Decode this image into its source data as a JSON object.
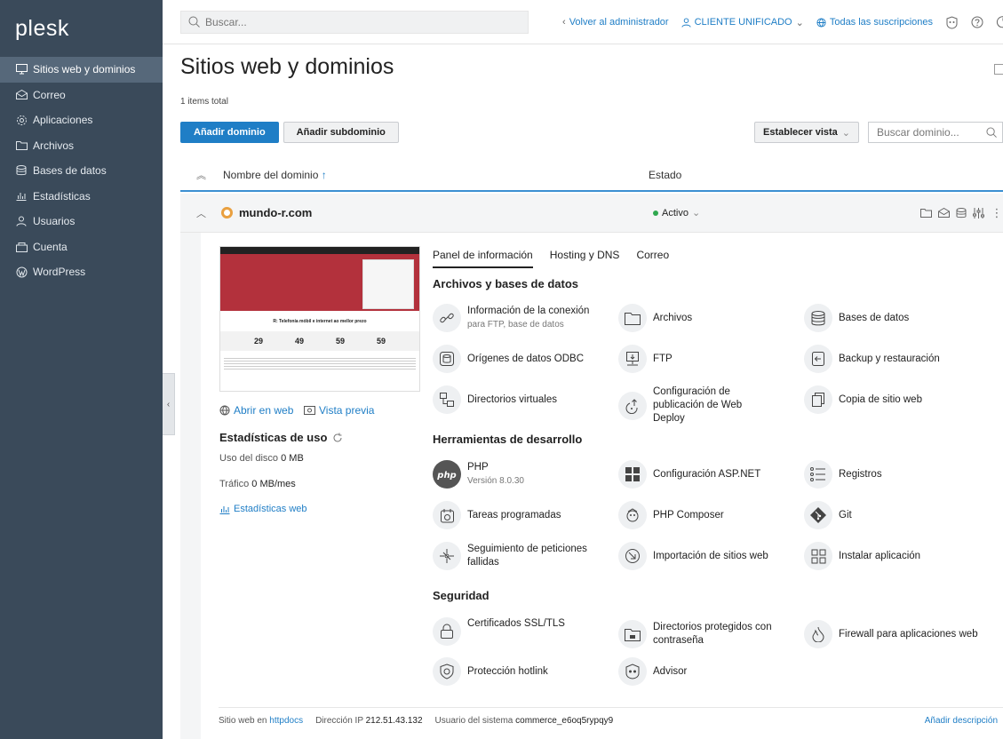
{
  "sidebar": {
    "logo": "plesk",
    "items": [
      {
        "label": "Sitios web y dominios",
        "icon": "monitor-icon",
        "active": true
      },
      {
        "label": "Correo",
        "icon": "mail-icon"
      },
      {
        "label": "Aplicaciones",
        "icon": "gear-icon"
      },
      {
        "label": "Archivos",
        "icon": "folder-icon"
      },
      {
        "label": "Bases de datos",
        "icon": "database-icon"
      },
      {
        "label": "Estadísticas",
        "icon": "bar-chart-icon"
      },
      {
        "label": "Usuarios",
        "icon": "user-icon"
      },
      {
        "label": "Cuenta",
        "icon": "account-icon"
      },
      {
        "label": "WordPress",
        "icon": "wordpress-icon"
      }
    ]
  },
  "topbar": {
    "search_placeholder": "Buscar...",
    "back_to_admin": "Volver al administrador",
    "customer": "CLIENTE UNIFICADO",
    "subscriptions": "Todas las suscripciones"
  },
  "page": {
    "title": "Sitios web y dominios",
    "items_total": "1 items total",
    "add_domain": "Añadir dominio",
    "add_subdomain": "Añadir subdominio",
    "set_view": "Establecer vista",
    "domain_search_placeholder": "Buscar dominio...",
    "col_domain": "Nombre del dominio",
    "col_status": "Estado"
  },
  "domain": {
    "name": "mundo-r.com",
    "status": "Activo",
    "open_web": "Abrir en web",
    "preview": "Vista previa",
    "stats_title": "Estadísticas de uso",
    "disk_label": "Uso del disco",
    "disk_value": "0 MB",
    "traffic_label": "Tráfico",
    "traffic_value": "0 MB/mes",
    "web_stats": "Estadísticas web",
    "thumb_banner": "R: Telefonía móbil e internet ao mellor prezo",
    "thumb_prices": [
      "29",
      "49",
      "59",
      "59"
    ]
  },
  "tabs": [
    "Panel de información",
    "Hosting y DNS",
    "Correo"
  ],
  "sections": {
    "files": {
      "title": "Archivos y bases de datos",
      "tools": [
        {
          "label": "Información de la conexión",
          "sub": "para FTP, base de datos",
          "icon": "link-icon"
        },
        {
          "label": "Archivos",
          "icon": "folder-icon"
        },
        {
          "label": "Bases de datos",
          "icon": "database-icon"
        },
        {
          "label": "Orígenes de datos ODBC",
          "icon": "odbc-icon"
        },
        {
          "label": "FTP",
          "icon": "ftp-icon"
        },
        {
          "label": "Backup y restauración",
          "icon": "backup-icon"
        },
        {
          "label": "Directorios virtuales",
          "icon": "virtual-dirs-icon"
        },
        {
          "label": "Configuración de publicación de Web Deploy",
          "icon": "web-deploy-icon"
        },
        {
          "label": "Copia de sitio web",
          "icon": "copy-icon"
        }
      ]
    },
    "dev": {
      "title": "Herramientas de desarrollo",
      "tools": [
        {
          "label": "PHP",
          "sub": "Versión 8.0.30",
          "icon": "php-icon"
        },
        {
          "label": "Configuración ASP.NET",
          "icon": "aspnet-icon"
        },
        {
          "label": "Registros",
          "icon": "logs-icon"
        },
        {
          "label": "Tareas programadas",
          "icon": "calendar-icon"
        },
        {
          "label": "PHP Composer",
          "icon": "composer-icon"
        },
        {
          "label": "Git",
          "icon": "git-icon"
        },
        {
          "label": "Seguimiento de peticiones fallidas",
          "icon": "failed-requests-icon"
        },
        {
          "label": "Importación de sitios web",
          "icon": "import-icon"
        },
        {
          "label": "Instalar aplicación",
          "icon": "apps-icon"
        }
      ]
    },
    "security": {
      "title": "Seguridad",
      "tools": [
        {
          "label": "Certificados SSL/TLS",
          "icon": "lock-icon"
        },
        {
          "label": "Directorios protegidos con contraseña",
          "icon": "protected-dir-icon"
        },
        {
          "label": "Firewall para aplicaciones web",
          "icon": "firewall-icon"
        },
        {
          "label": "Protección hotlink",
          "icon": "shield-icon"
        },
        {
          "label": "Advisor",
          "icon": "advisor-icon"
        }
      ]
    }
  },
  "footer": {
    "site_label": "Sitio web en",
    "site_value": "httpdocs",
    "ip_label": "Dirección IP",
    "ip_value": "212.51.43.132",
    "user_label": "Usuario del sistema",
    "user_value": "commerce_e6oq5rypqy9",
    "add_description": "Añadir descripción"
  },
  "colors": {
    "sidebar": "#3a4a5a",
    "accent": "#1f7ec6",
    "active": "#2fa84f",
    "thumb_red": "#b3313c"
  }
}
